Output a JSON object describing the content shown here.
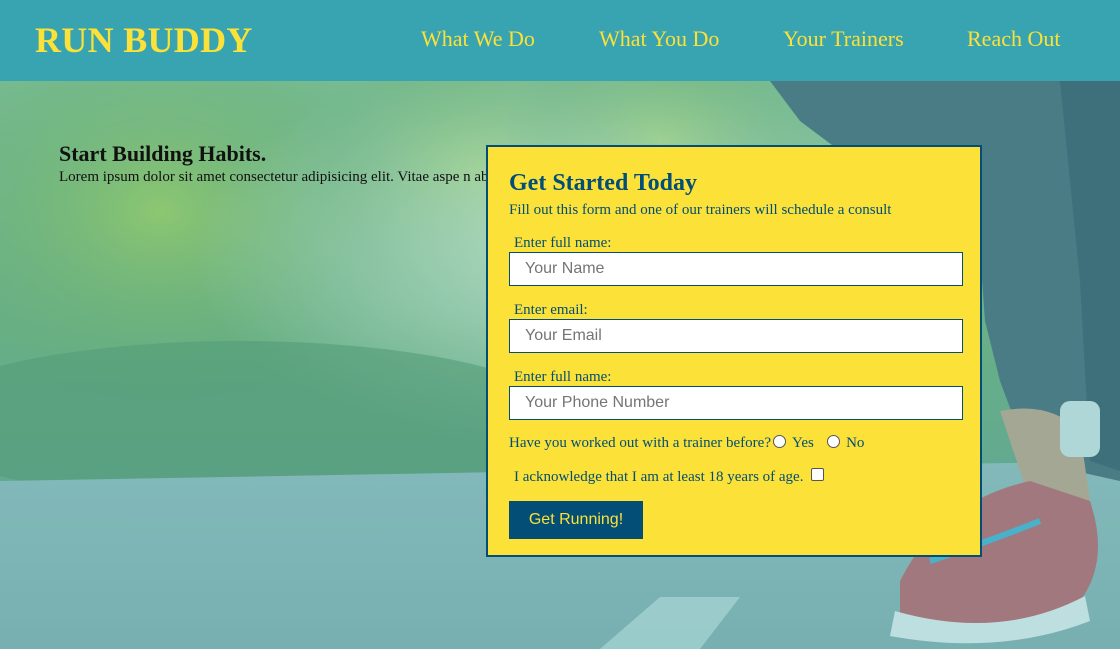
{
  "header": {
    "logo": "RUN BUDDY",
    "nav": [
      "What We Do",
      "What You Do",
      "Your Trainers",
      "Reach Out"
    ]
  },
  "intro": {
    "title": "Start Building Habits.",
    "body": "Lorem ipsum dolor sit amet consectetur adipisicing elit. Vitae aspe                                                                                                               n ab doloremque cupiditate aspernatur quas aut, numquam his maiores"
  },
  "form": {
    "title": "Get Started Today",
    "subtitle": "Fill out this form and one of our trainers will schedule a consult",
    "name_label": "Enter full name:",
    "name_placeholder": "Your Name",
    "email_label": "Enter email:",
    "email_placeholder": "Your Email",
    "phone_label": "Enter full name:",
    "phone_placeholder": "Your Phone Number",
    "trainer_question": "Have you worked out with a trainer before?",
    "option_yes": "Yes",
    "option_no": "No",
    "acknowledge": "I acknowledge that I am at least 18 years of age.",
    "submit": "Get Running!"
  },
  "colors": {
    "header_bg": "#39a4b1",
    "accent_yellow": "#fce138",
    "dark_blue": "#024e76"
  }
}
